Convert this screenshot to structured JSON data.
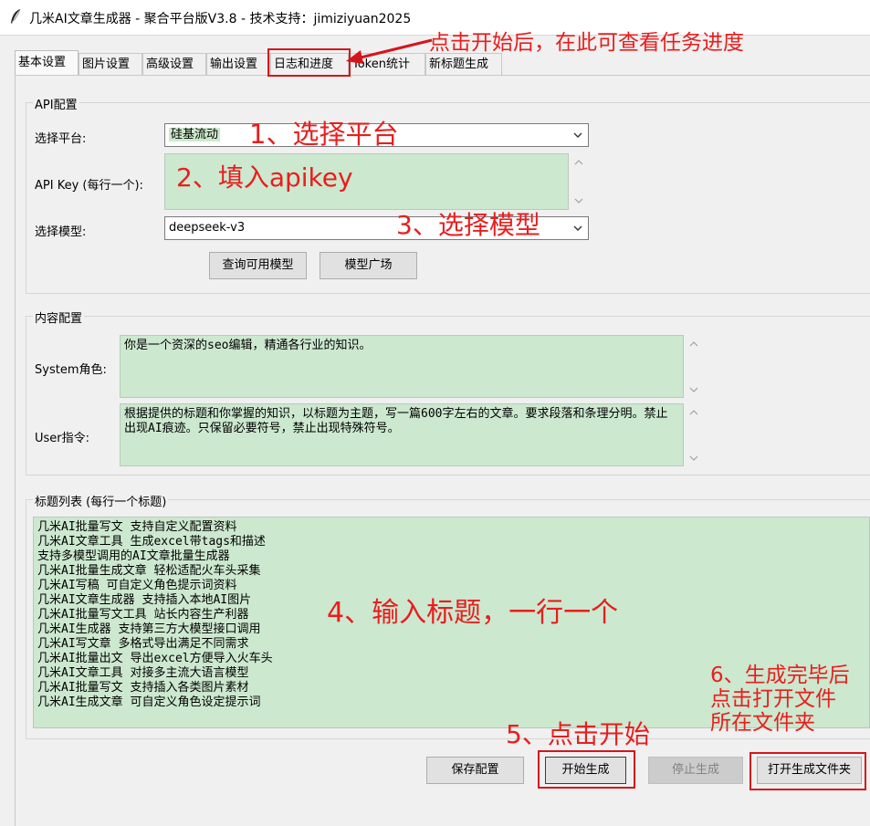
{
  "window": {
    "title": "几米AI文章生成器 - 聚合平台版V3.8 - 技术支持：jimiziyuan2025",
    "icon": "feather-icon"
  },
  "tabs": [
    {
      "label": "基本设置",
      "active": true
    },
    {
      "label": "图片设置"
    },
    {
      "label": "高级设置"
    },
    {
      "label": "输出设置"
    },
    {
      "label": "日志和进度"
    },
    {
      "label": "Token统计"
    },
    {
      "label": "新标题生成"
    }
  ],
  "api_config": {
    "group_title": "API配置",
    "platform_label": "选择平台:",
    "platform_value": "硅基流动",
    "apikey_label": "API Key (每行一个):",
    "apikey_value": "",
    "model_label": "选择模型:",
    "model_value": "deepseek-v3",
    "query_models_button": "查询可用模型",
    "model_plaza_button": "模型广场"
  },
  "content_config": {
    "group_title": "内容配置",
    "system_label": "System角色:",
    "system_value": "你是一个资深的seo编辑，精通各行业的知识。",
    "user_label": "User指令:",
    "user_value": "根据提供的标题和你掌握的知识，以标题为主题，写一篇600字左右的文章。要求段落和条理分明。禁止出现AI痕迹。只保留必要符号，禁止出现特殊符号。"
  },
  "titles": {
    "group_title": "标题列表 (每行一个标题)",
    "value": "几米AI批量写文 支持自定义配置资料\n几米AI文章工具 生成excel带tags和描述\n支持多模型调用的AI文章批量生成器\n几米AI批量生成文章 轻松适配火车头采集\n几米AI写稿 可自定义角色提示词资料\n几米AI文章生成器 支持插入本地AI图片\n几米AI批量写文工具 站长内容生产利器\n几米AI生成器 支持第三方大模型接口调用\n几米AI写文章 多格式导出满足不同需求\n几米AI批量出文 导出excel方便导入火车头\n几米AI文章工具 对接多主流大语言模型\n几米AI批量写文 支持插入各类图片素材\n几米AI生成文章 可自定义角色设定提示词"
  },
  "buttons": {
    "save": "保存配置",
    "start": "开始生成",
    "stop": "停止生成",
    "open_folder": "打开生成文件夹"
  },
  "annotations": {
    "progress_tip": "点击开始后，在此可查看任务进度",
    "step1": "1、选择平台",
    "step2": "2、填入apikey",
    "step3": "3、选择模型",
    "step4": "4、输入标题，一行一个",
    "step5": "5、点击开始",
    "step6": "6、生成完毕后\n点击打开文件\n所在文件夹"
  },
  "colors": {
    "annotation_red": "#e81e1e",
    "textarea_green": "#cce8cf",
    "window_bg": "#f0f0f0"
  }
}
